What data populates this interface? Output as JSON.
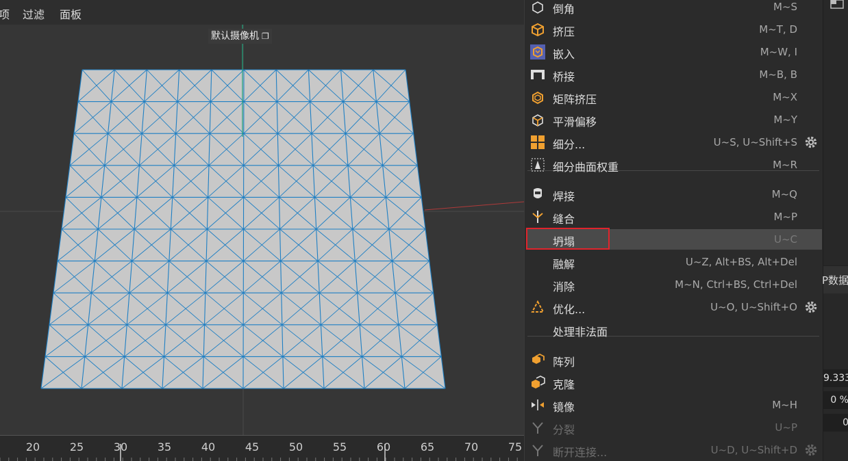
{
  "menubar": {
    "items": [
      {
        "label": "项"
      },
      {
        "label": "过滤"
      },
      {
        "label": "面板"
      }
    ]
  },
  "viewport": {
    "camera_label": "默认摄像机",
    "ruler_ticks": [
      "20",
      "25",
      "30",
      "35",
      "40",
      "45",
      "50",
      "55",
      "60",
      "65",
      "70",
      "75"
    ]
  },
  "context_menu": {
    "items": [
      {
        "label": "倒角",
        "shortcut": "M~S",
        "icon": "bevel-icon"
      },
      {
        "label": "挤压",
        "shortcut": "M~T, D",
        "icon": "extrude-icon"
      },
      {
        "label": "嵌入",
        "shortcut": "M~W, I",
        "icon": "inset-icon"
      },
      {
        "label": "桥接",
        "shortcut": "M~B, B",
        "icon": "bridge-icon"
      },
      {
        "label": "矩阵挤压",
        "shortcut": "M~X",
        "icon": "matrix-extrude-icon"
      },
      {
        "label": "平滑偏移",
        "shortcut": "M~Y",
        "icon": "smooth-shift-icon"
      },
      {
        "label": "细分...",
        "shortcut": "U~S, U~Shift+S",
        "icon": "subdivide-icon",
        "gear": true
      },
      {
        "label": "细分曲面权重",
        "shortcut": "M~R",
        "icon": "subdivision-weight-icon"
      },
      {
        "label": "焊接",
        "shortcut": "M~Q",
        "icon": "weld-icon"
      },
      {
        "label": "缝合",
        "shortcut": "M~P",
        "icon": "stitch-icon"
      },
      {
        "label": "坍塌",
        "shortcut": "U~C",
        "icon": "",
        "highlight": true
      },
      {
        "label": "融解",
        "shortcut": "U~Z, Alt+BS, Alt+Del",
        "icon": ""
      },
      {
        "label": "消除",
        "shortcut": "M~N, Ctrl+BS, Ctrl+Del",
        "icon": ""
      },
      {
        "label": "优化...",
        "shortcut": "U~O, U~Shift+O",
        "icon": "optimize-icon",
        "gear": true
      },
      {
        "label": "处理非法面",
        "shortcut": "",
        "icon": ""
      },
      {
        "label": "阵列",
        "shortcut": "",
        "icon": "array-icon"
      },
      {
        "label": "克隆",
        "shortcut": "",
        "icon": "clone-icon"
      },
      {
        "label": "镜像",
        "shortcut": "M~H",
        "icon": "mirror-icon"
      },
      {
        "label": "分裂",
        "shortcut": "U~P",
        "icon": "split-icon",
        "disabled": true
      },
      {
        "label": "断开连接...",
        "shortcut": "U~D, U~Shift+D",
        "icon": "disconnect-icon",
        "disabled": true,
        "gear": true
      }
    ]
  },
  "side_panel": {
    "tab_label": "P数据",
    "fields": [
      "9.333",
      "0 %",
      "0"
    ]
  },
  "colors": {
    "accent_orange": "#f0a030",
    "mesh_line": "#1e7fc4",
    "mesh_fill": "#c8c8c8",
    "highlight_box": "#e0242c"
  }
}
